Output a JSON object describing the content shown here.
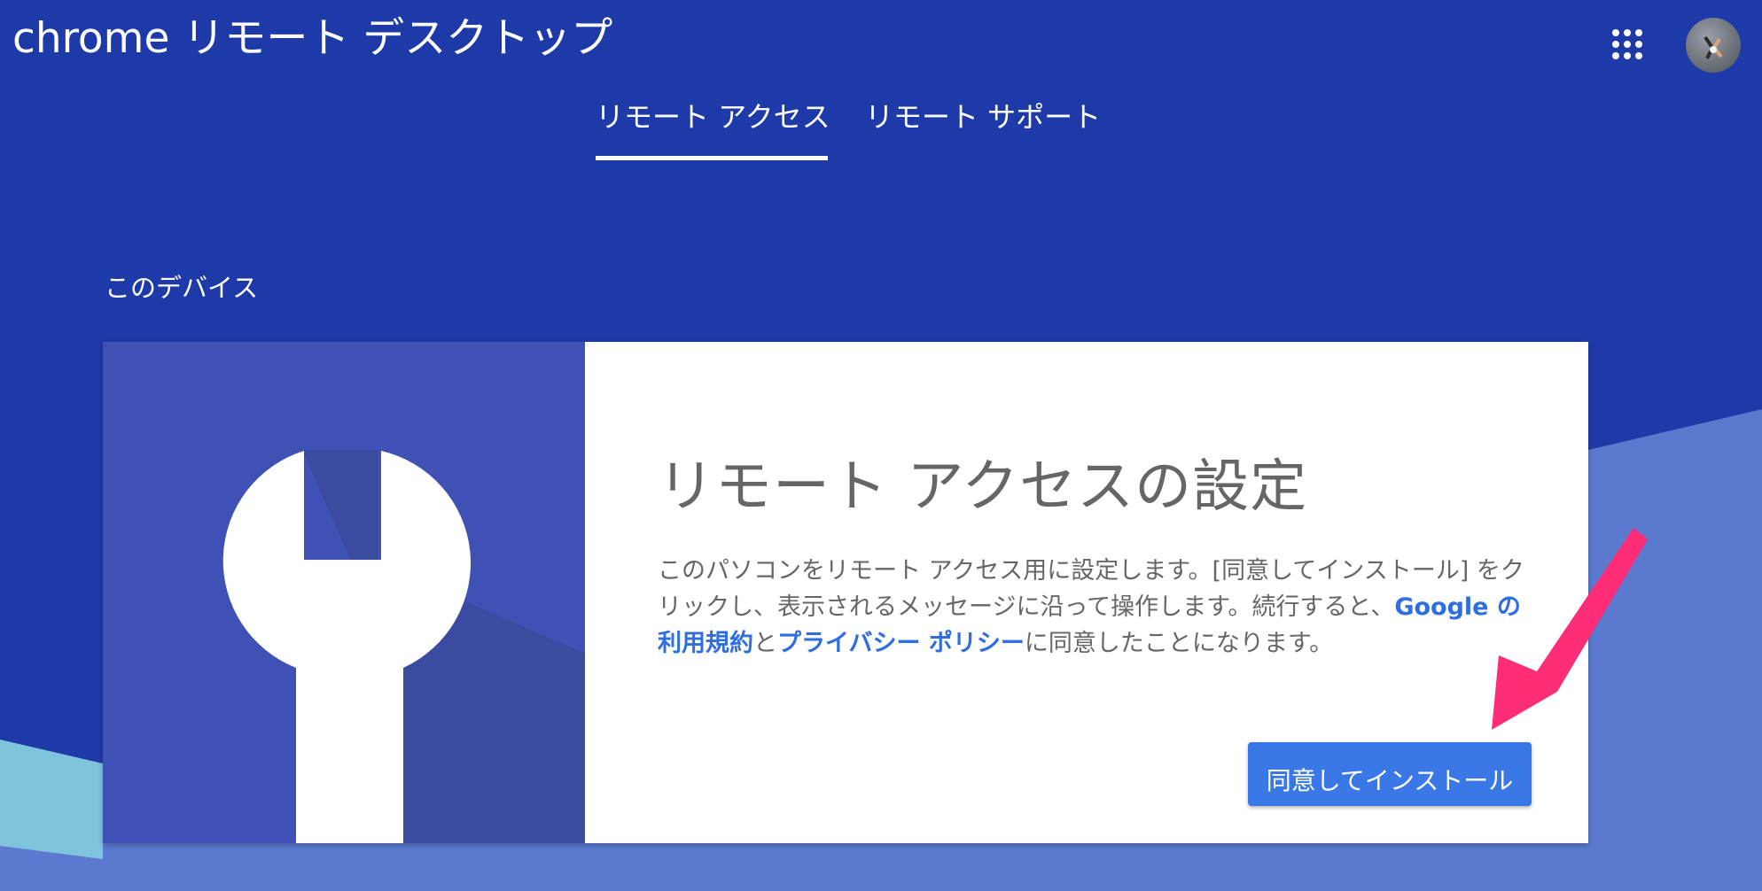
{
  "app": {
    "title": "chrome リモート デスクトップ"
  },
  "header": {
    "apps_icon": "apps-grid-icon",
    "avatar": "user-avatar"
  },
  "tabs": [
    {
      "label": "リモート アクセス",
      "active": true
    },
    {
      "label": "リモート サポート",
      "active": false
    }
  ],
  "section": {
    "title": "このデバイス"
  },
  "card": {
    "illustration_icon": "wrench-icon",
    "heading": "リモート アクセスの設定",
    "description_part1": "このパソコンをリモート アクセス用に設定します。[同意してインストール] をクリックし、表示されるメッセージに沿って操作します。続行すると、",
    "link_terms": "Google の利用規約",
    "description_part2": "と",
    "link_privacy": "プライバシー ポリシー",
    "description_part3": "に同意したことになります。",
    "button_label": "同意してインストール"
  },
  "colors": {
    "background": "#1e3aa8",
    "illustration": "#3f51b5",
    "button": "#3b78e7",
    "link": "#2f6ee0",
    "annotation_arrow": "#ff2d78"
  }
}
